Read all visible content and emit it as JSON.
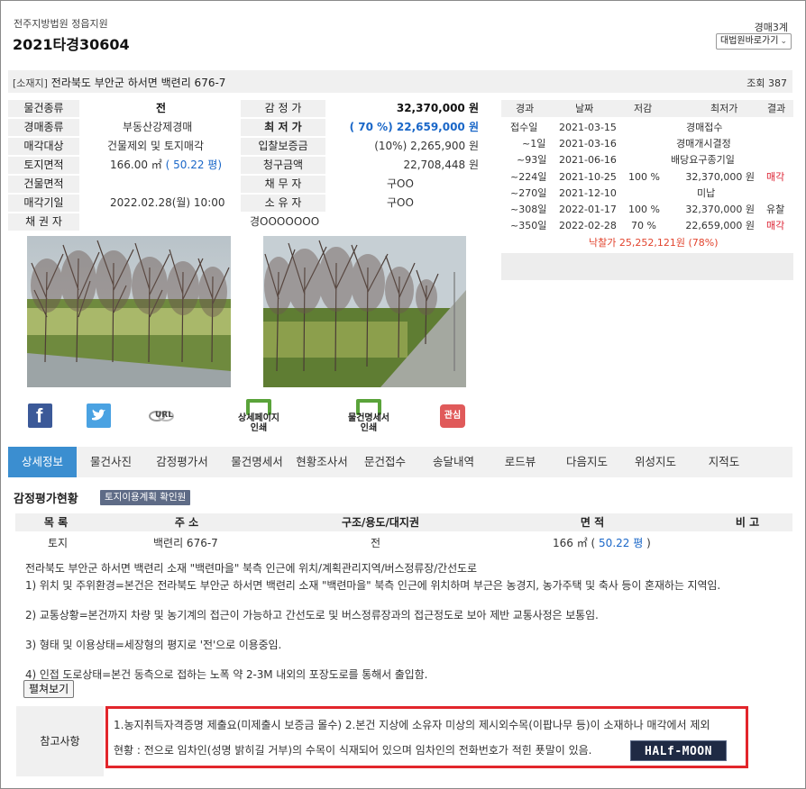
{
  "header": {
    "court": "전주지방법원 정읍지원",
    "case_no": "2021타경30604",
    "dept": "경매3계",
    "shortcut": "대법원바로가기"
  },
  "address_bar": {
    "tag": "[소재지]",
    "address": "전라북도 부안군 하서면 백련리 676-7",
    "views": "조회 387"
  },
  "info": {
    "labels_left": [
      "물건종류",
      "경매종류",
      "매각대상",
      "토지면적",
      "건물면적",
      "매각기일",
      "채 권 자"
    ],
    "labels_right": [
      "감 정 가",
      "최 저 가",
      "입찰보증금",
      "청구금액",
      "채 무 자",
      "소 유 자"
    ],
    "item_type": "전",
    "auction_type": "부동산강제경매",
    "sale_target": "건물제외 및 토지매각",
    "land_area": "166.00 ㎡",
    "land_area_py": "( 50.22 평)",
    "building_area": "",
    "sale_date": "2022.02.28(월) 10:00",
    "creditor": "경OOOOOOO",
    "appraisal": "32,370,000 원",
    "min_price": "( 70 %) 22,659,000 원",
    "deposit": "(10%) 2,265,900 원",
    "claim": "22,708,448 원",
    "debtor": "구OO",
    "owner": "구OO"
  },
  "history": {
    "headers": [
      "경과",
      "날짜",
      "저감",
      "최저가",
      "결과"
    ],
    "rows": [
      {
        "elapsed": "접수일",
        "date": "2021-03-15",
        "rate": "",
        "price": "경매접수",
        "result": ""
      },
      {
        "elapsed": "~1일",
        "date": "2021-03-16",
        "rate": "",
        "price": "경매개시결정",
        "result": ""
      },
      {
        "elapsed": "~93일",
        "date": "2021-06-16",
        "rate": "",
        "price": "배당요구종기일",
        "result": ""
      },
      {
        "elapsed": "~224일",
        "date": "2021-10-25",
        "rate": "100 %",
        "price": "32,370,000 원",
        "result": "매각"
      },
      {
        "elapsed": "~270일",
        "date": "2021-12-10",
        "rate": "",
        "price": "미납",
        "result": ""
      },
      {
        "elapsed": "~308일",
        "date": "2022-01-17",
        "rate": "100 %",
        "price": "32,370,000 원",
        "result": "유찰"
      },
      {
        "elapsed": "~350일",
        "date": "2022-02-28",
        "rate": "70 %",
        "price": "22,659,000 원",
        "result": "매각"
      }
    ],
    "winning": "낙찰가 25,252,121원 (78%)"
  },
  "icons": {
    "url": "URL",
    "detail_print": "상세페이지 인쇄",
    "item_print": "물건명세서 인쇄",
    "interest": "관심"
  },
  "tabs": [
    "상세정보",
    "물건사진",
    "감정평가서",
    "물건명세서",
    "현황조사서",
    "문건접수",
    "송달내역",
    "로드뷰",
    "다음지도",
    "위성지도",
    "지적도"
  ],
  "appraisal_section": {
    "title": "감정평가현황",
    "button": "토지이용계획 확인원",
    "headers": [
      "목 록",
      "주 소",
      "구조/용도/대지권",
      "면 적",
      "비 고"
    ],
    "row": {
      "kind": "토지",
      "addr": "백련리 676-7",
      "use": "전",
      "area": "166 ㎡ (",
      "area_py": "50.22 평",
      "area_close": ")",
      "note": ""
    },
    "lines": [
      "전라북도 부안군 하서면 백련리 소재 \"백련마을\" 북측 인근에 위치/계획관리지역/버스정류장/간선도로",
      "1) 위치 및 주위환경=본건은 전라북도 부안군 하서면 백련리 소재 \"백련마을\" 북측 인근에 위치하며 부근은 농경지, 농가주택 및 축사 등이 혼재하는 지역임.",
      "2) 교통상황=본건까지 차량 및 농기계의 접근이 가능하고 간선도로 및 버스정류장과의 접근정도로 보아 제반 교통사정은 보통임.",
      "3) 형태 및 이용상태=세장형의 평지로 '전'으로 이용중임.",
      "4) 인접 도로상태=본건 동측으로 접하는 노폭 약 2-3M 내외의 포장도로를 통해서 출입함."
    ],
    "expand": "펼쳐보기"
  },
  "note": {
    "label": "참고사항",
    "line1": "1.농지취득자격증명 제출요(미제출시 보증금 몰수) 2.본건 지상에 소유자 미상의 제시외수목(이팝나무 등)이 소재하나 매각에서 제외",
    "line2": "현황 : 전으로 임차인(성명 밝히길 거부)의 수목이 식재되어 있으며 임차인의 전화번호가 적힌 푯말이 있음.",
    "logo": "HALf-MOON"
  },
  "colors": {
    "tab_active": "#3b8ed0",
    "blue_text": "#1a67c8",
    "red_text": "#e2442e",
    "note_border": "#e2252b"
  }
}
